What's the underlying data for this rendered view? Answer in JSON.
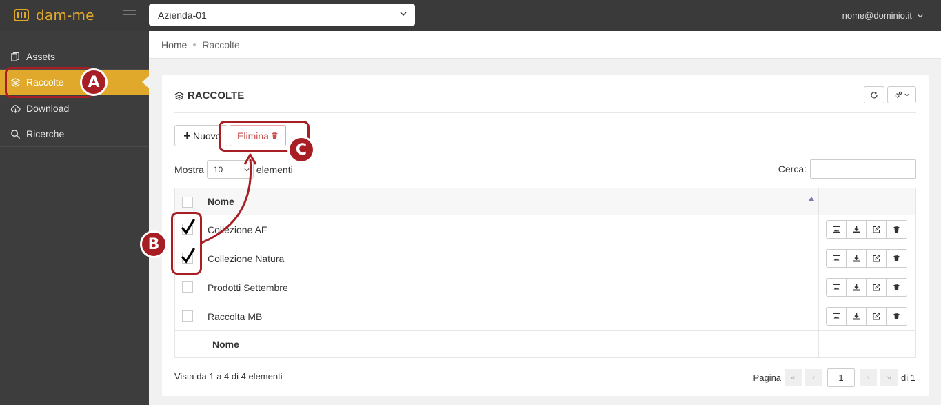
{
  "app": {
    "logo_text": "dam-me",
    "brand_color": "#e0a92b",
    "company_select": "Azienda-01",
    "user": "nome@dominio.it"
  },
  "sidebar": {
    "items": [
      {
        "label": "Assets",
        "icon": "assets-icon"
      },
      {
        "label": "Raccolte",
        "icon": "layers-icon",
        "active": true
      },
      {
        "label": "Download",
        "icon": "cloud-download-icon"
      },
      {
        "label": "Ricerche",
        "icon": "search-icon"
      }
    ]
  },
  "breadcrumb": {
    "home": "Home",
    "current": "Raccolte"
  },
  "card": {
    "title": "RACCOLTE",
    "new_label": "Nuovo",
    "delete_label": "Elimina",
    "show_label": "Mostra",
    "page_size": "10",
    "elements_label": "elementi",
    "search_label": "Cerca:",
    "search_value": ""
  },
  "table": {
    "header_name": "Nome",
    "footer_name": "Nome",
    "rows": [
      {
        "name": "Collezione AF",
        "checked": true
      },
      {
        "name": "Collezione Natura",
        "checked": true
      },
      {
        "name": "Prodotti Settembre",
        "checked": false
      },
      {
        "name": "Raccolta MB",
        "checked": false
      }
    ]
  },
  "footer": {
    "info": "Vista da 1 a 4 di 4 elementi",
    "page_label": "Pagina",
    "page": "1",
    "of_label": "di 1",
    "first": "«",
    "prev": "‹",
    "next": "›",
    "last": "»"
  },
  "annotations": {
    "a": "A",
    "b": "B",
    "c": "C",
    "color": "#a71f24"
  }
}
